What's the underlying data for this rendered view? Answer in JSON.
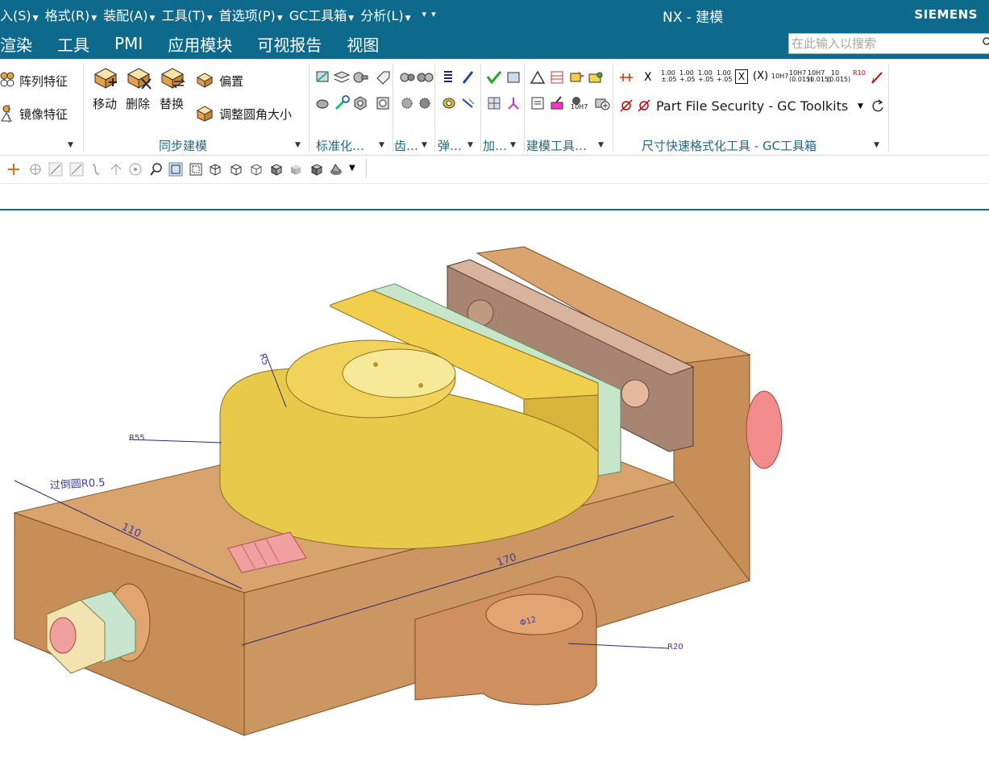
{
  "menubar": {
    "items": [
      {
        "label": "入(S)"
      },
      {
        "label": "格式(R)"
      },
      {
        "label": "装配(A)"
      },
      {
        "label": "工具(T)"
      },
      {
        "label": "首选项(P)"
      },
      {
        "label": "GC工具箱"
      },
      {
        "label": "分析(L)"
      }
    ],
    "title": "NX - 建模",
    "brand": "SIEMENS"
  },
  "tabs": [
    {
      "label": "渲染"
    },
    {
      "label": "工具"
    },
    {
      "label": "PMI"
    },
    {
      "label": "应用模块"
    },
    {
      "label": "可视报告"
    },
    {
      "label": "视图"
    }
  ],
  "search": {
    "placeholder": "在此输入以搜索",
    "value": ""
  },
  "ribbon": {
    "pattern_feature": "阵列特征",
    "mirror_feature": "镜像特征",
    "move": "移动",
    "delete": "删除",
    "replace": "替换",
    "offset": "偏置",
    "resize_blend": "调整圆角大小",
    "groups": {
      "sync": "同步建模",
      "standard": "标准化…",
      "gear": "齿…",
      "spring": "弹…",
      "machining": "加…",
      "modeling_tools": "建模工具…",
      "dim_format": "尺寸快速格式化工具 - GC工具箱"
    },
    "dim": {
      "t1": "1.00",
      "t2": "±.05",
      "t3": "1.00",
      "t4": "+.05",
      "t5": "1.00",
      "t6": "+.05",
      "t7": "1.00",
      "t8": "+.05",
      "h1": "10H7",
      "h2": "10H7",
      "h3": "10H7",
      "h4": "(0.015)",
      "h5": "10H7",
      "h6": "(0.015)",
      "h7": "10",
      "h8": "(0.015)",
      "x": "X",
      "xbox": "X",
      "xparen": "(X)",
      "ptx": "10H7",
      "rot": "R10"
    },
    "part_file_security": "Part File Security - GC Toolkits"
  },
  "drawing": {
    "annotations": {
      "r5": "R5",
      "r55": "R55",
      "chamfer": "过倒圆R0.5",
      "d110": "110",
      "d170": "170",
      "r20": "R20",
      "phi12": "Φ12"
    }
  },
  "colors": {
    "brand": "#0e6a8c",
    "base": "#d19a66",
    "jaw": "#e9c43c",
    "pad": "#c9e6cc"
  }
}
